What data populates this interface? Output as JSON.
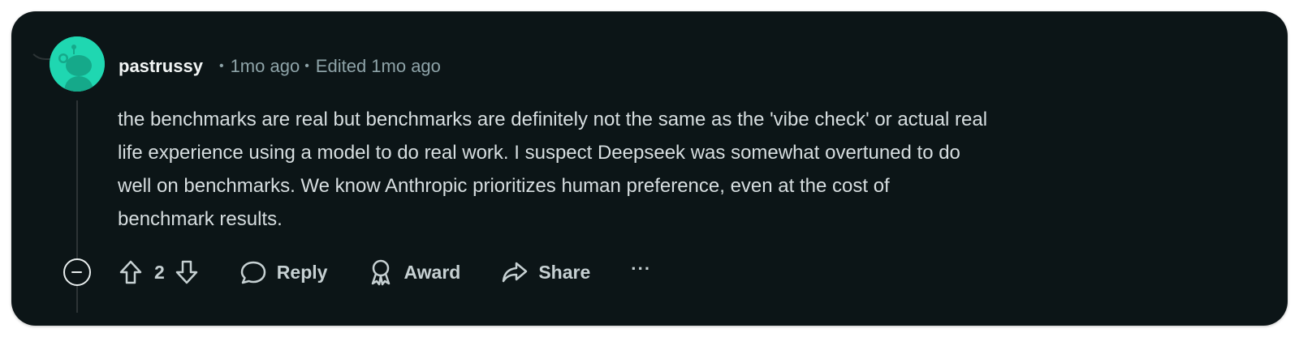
{
  "comment": {
    "author": "pastrussy",
    "posted_ago": "1mo ago",
    "edited_label": "Edited 1mo ago",
    "separator": "•",
    "body_lines": [
      "the benchmarks are real but benchmarks are definitely not the same as the 'vibe check' or actual real",
      "life experience using a model to do real work. I suspect Deepseek was somewhat overtuned to do",
      "well on benchmarks. We know Anthropic prioritizes human preference, even at the cost of",
      "benchmark results."
    ],
    "vote_count": "2"
  },
  "actions": {
    "reply_label": "Reply",
    "award_label": "Award",
    "share_label": "Share",
    "more_label": "···"
  },
  "icons": {
    "avatar": "reddit-snoo-icon",
    "collapse": "collapse-icon",
    "upvote": "upvote-arrow-icon",
    "downvote": "downvote-arrow-icon",
    "reply": "speech-bubble-icon",
    "award": "award-ribbon-icon",
    "share": "share-arrow-icon",
    "more": "more-options-icon"
  },
  "colors": {
    "card_background": "#0c1517",
    "avatar_background": "#1fd7b1",
    "username": "#f2f5f5",
    "meta_text": "#8ea3a8",
    "body_text": "#d7dee0"
  }
}
